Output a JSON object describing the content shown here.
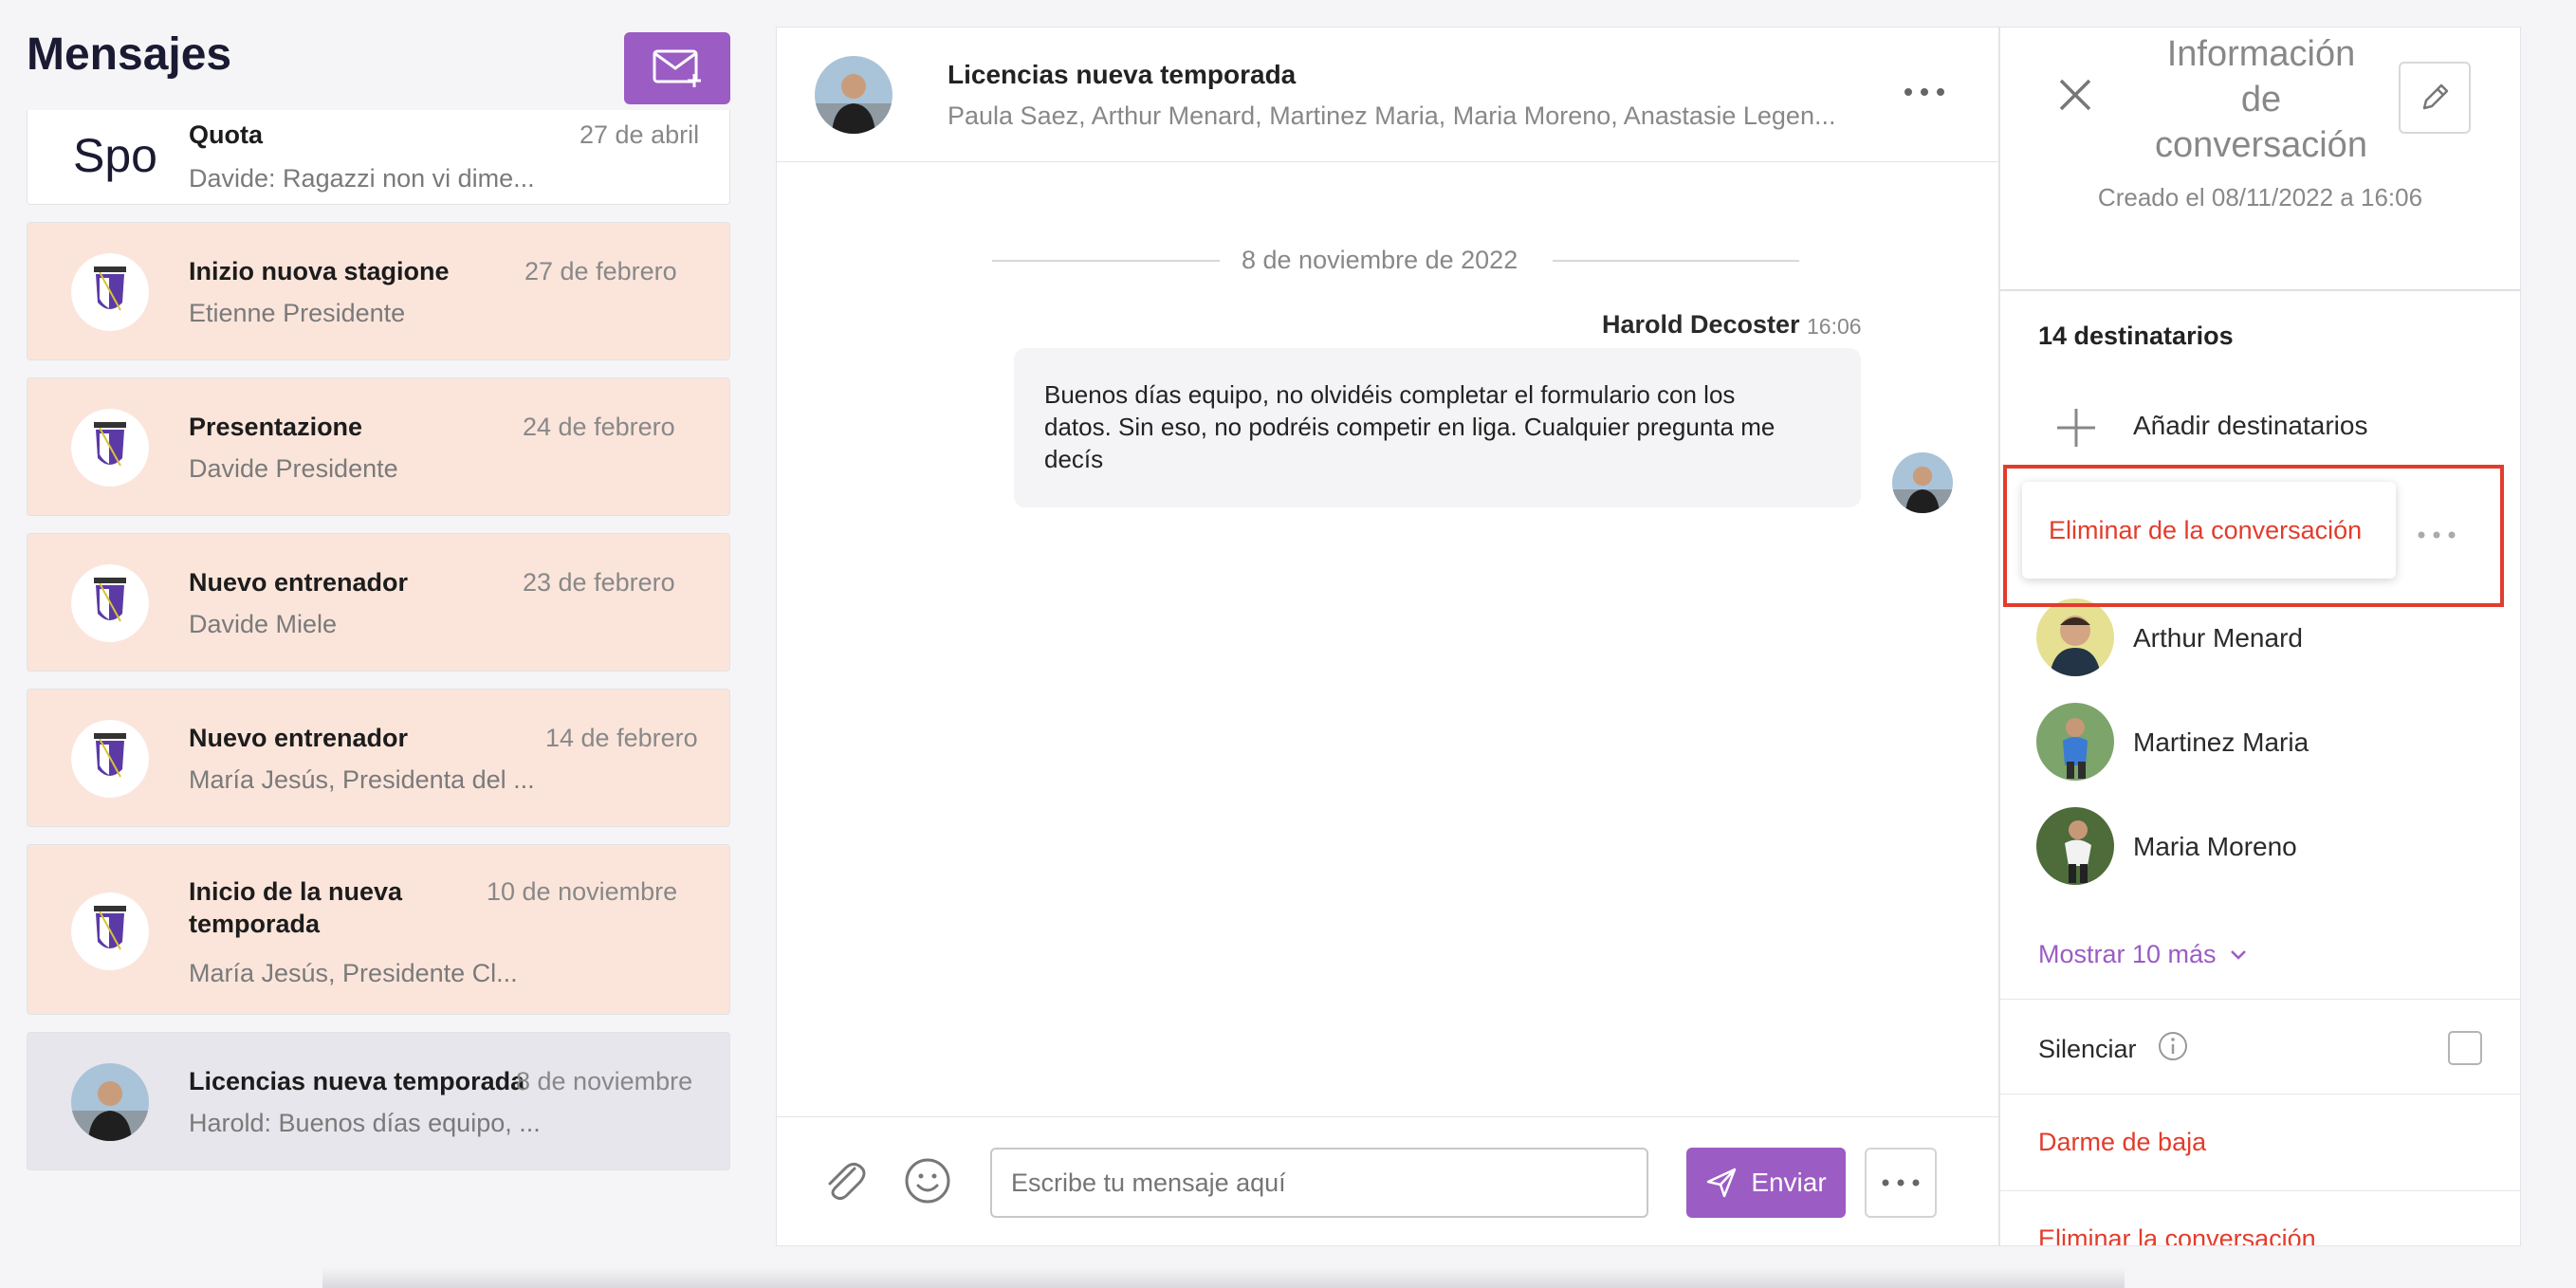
{
  "left": {
    "title": "Mensajes",
    "conversations": [
      {
        "title": "Quota",
        "date": "27 de abril",
        "preview": "Davide: Ragazzi non vi dime...",
        "avatar_text": "Spo"
      },
      {
        "title": "Inizio nuova stagione",
        "date": "27 de febrero",
        "preview": "Etienne Presidente"
      },
      {
        "title": "Presentazione",
        "date": "24 de febrero",
        "preview": "Davide Presidente"
      },
      {
        "title": "Nuevo entrenador",
        "date": "23 de febrero",
        "preview": "Davide Miele"
      },
      {
        "title": "Nuevo entrenador",
        "date": "14 de febrero",
        "preview": "María Jesús, Presidenta del ..."
      },
      {
        "title": "Inicio de la nueva",
        "title2": "temporada",
        "date": "10 de noviembre",
        "preview": "María Jesús, Presidente Cl..."
      },
      {
        "title": "Licencias nueva temporada",
        "date": "8 de noviembre",
        "preview": "Harold: Buenos días equipo, ..."
      }
    ]
  },
  "center": {
    "title": "Licencias nueva temporada",
    "participants": "Paula Saez, Arthur Menard, Martinez Maria, Maria Moreno, Anastasie Legen...",
    "date_divider": "8 de noviembre de 2022",
    "message": {
      "author": "Harold Decoster",
      "time": "16:06",
      "line1": "Buenos días equipo, no olvidéis completar el formulario con los",
      "line2": "datos. Sin eso, no podréis competir en liga. Cualquier pregunta me",
      "line3": "decís"
    },
    "input_placeholder": "Escribe tu mensaje aquí",
    "send_label": "Enviar"
  },
  "right": {
    "title_line1": "Información",
    "title_line2": "de",
    "title_line3": "conversación",
    "created": "Creado el 08/11/2022 a 16:06",
    "recipients_count": "14 destinatarios",
    "add_recipients": "Añadir destinatarios",
    "popup_action": "Eliminar de la conversación",
    "recipients": [
      "Arthur Menard",
      "Martinez Maria",
      "Maria Moreno"
    ],
    "show_more": "Mostrar 10 más",
    "mute_label": "Silenciar",
    "unsubscribe": "Darme de baja",
    "delete_conversation": "Eliminar la conversación"
  },
  "colors": {
    "accent": "#9b5cc4",
    "danger": "#e23c2c",
    "highlight_bg": "#fbe5db"
  }
}
